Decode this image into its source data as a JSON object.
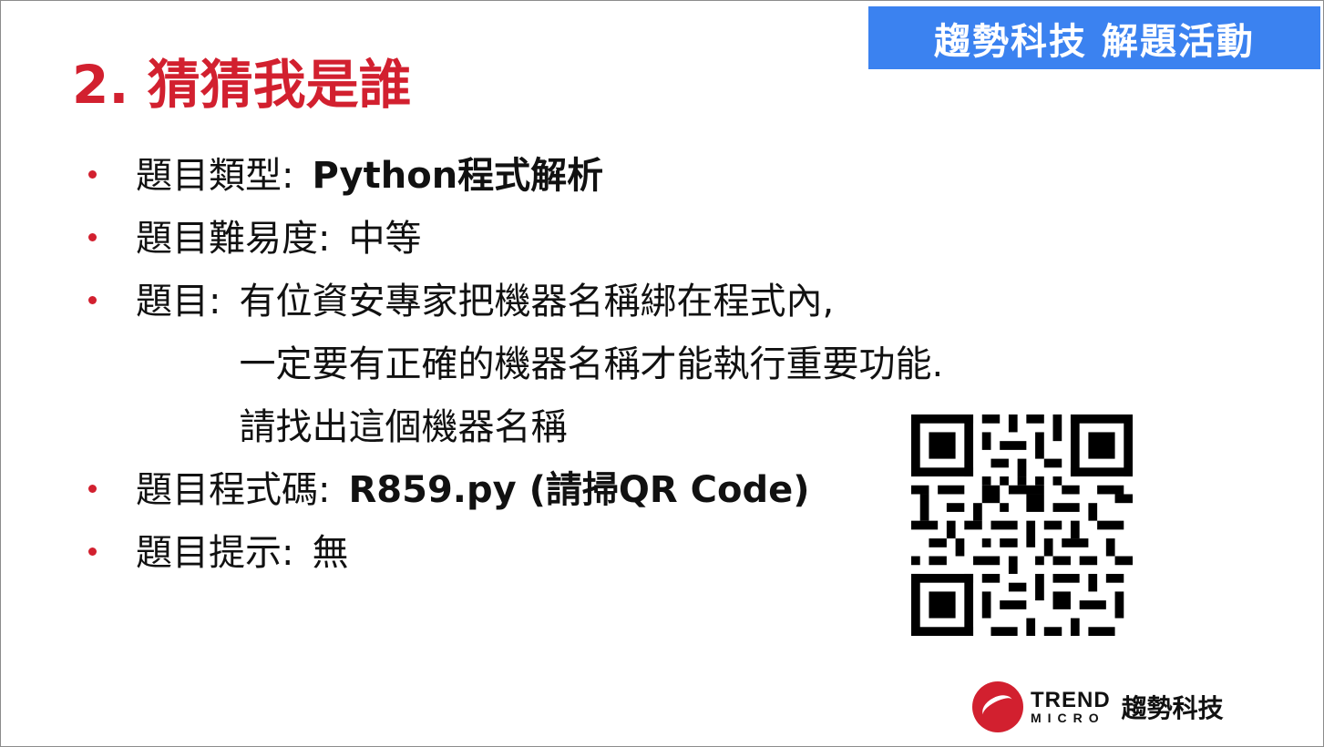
{
  "header": {
    "banner_text": "趨勢科技 解題活動"
  },
  "slide": {
    "title": "2. 猜猜我是誰"
  },
  "bullets": [
    {
      "label": "題目類型",
      "separator": ":",
      "value": "Python程式解析"
    },
    {
      "label": "題目難易度",
      "separator": ":",
      "value": "中等"
    },
    {
      "label": "題目",
      "separator": ":",
      "lines": [
        "有位資安專家把機器名稱綁在程式內,",
        "一定要有正確的機器名稱才能執行重要功能.",
        "請找出這個機器名稱"
      ]
    },
    {
      "label": "題目程式碼",
      "separator": ":",
      "value": "R859.py (請掃QR Code)"
    },
    {
      "label": "題目提示",
      "separator": ":",
      "value": "無"
    }
  ],
  "footer": {
    "brand_trend": "TREND",
    "brand_micro": "MICRO",
    "brand_cn": "趨勢科技"
  },
  "colors": {
    "title": "#d2202f",
    "banner": "#3b82f0",
    "bullet": "#d2202f"
  },
  "icons": {
    "qr": "qr-code",
    "logo": "trend-micro-logo"
  }
}
